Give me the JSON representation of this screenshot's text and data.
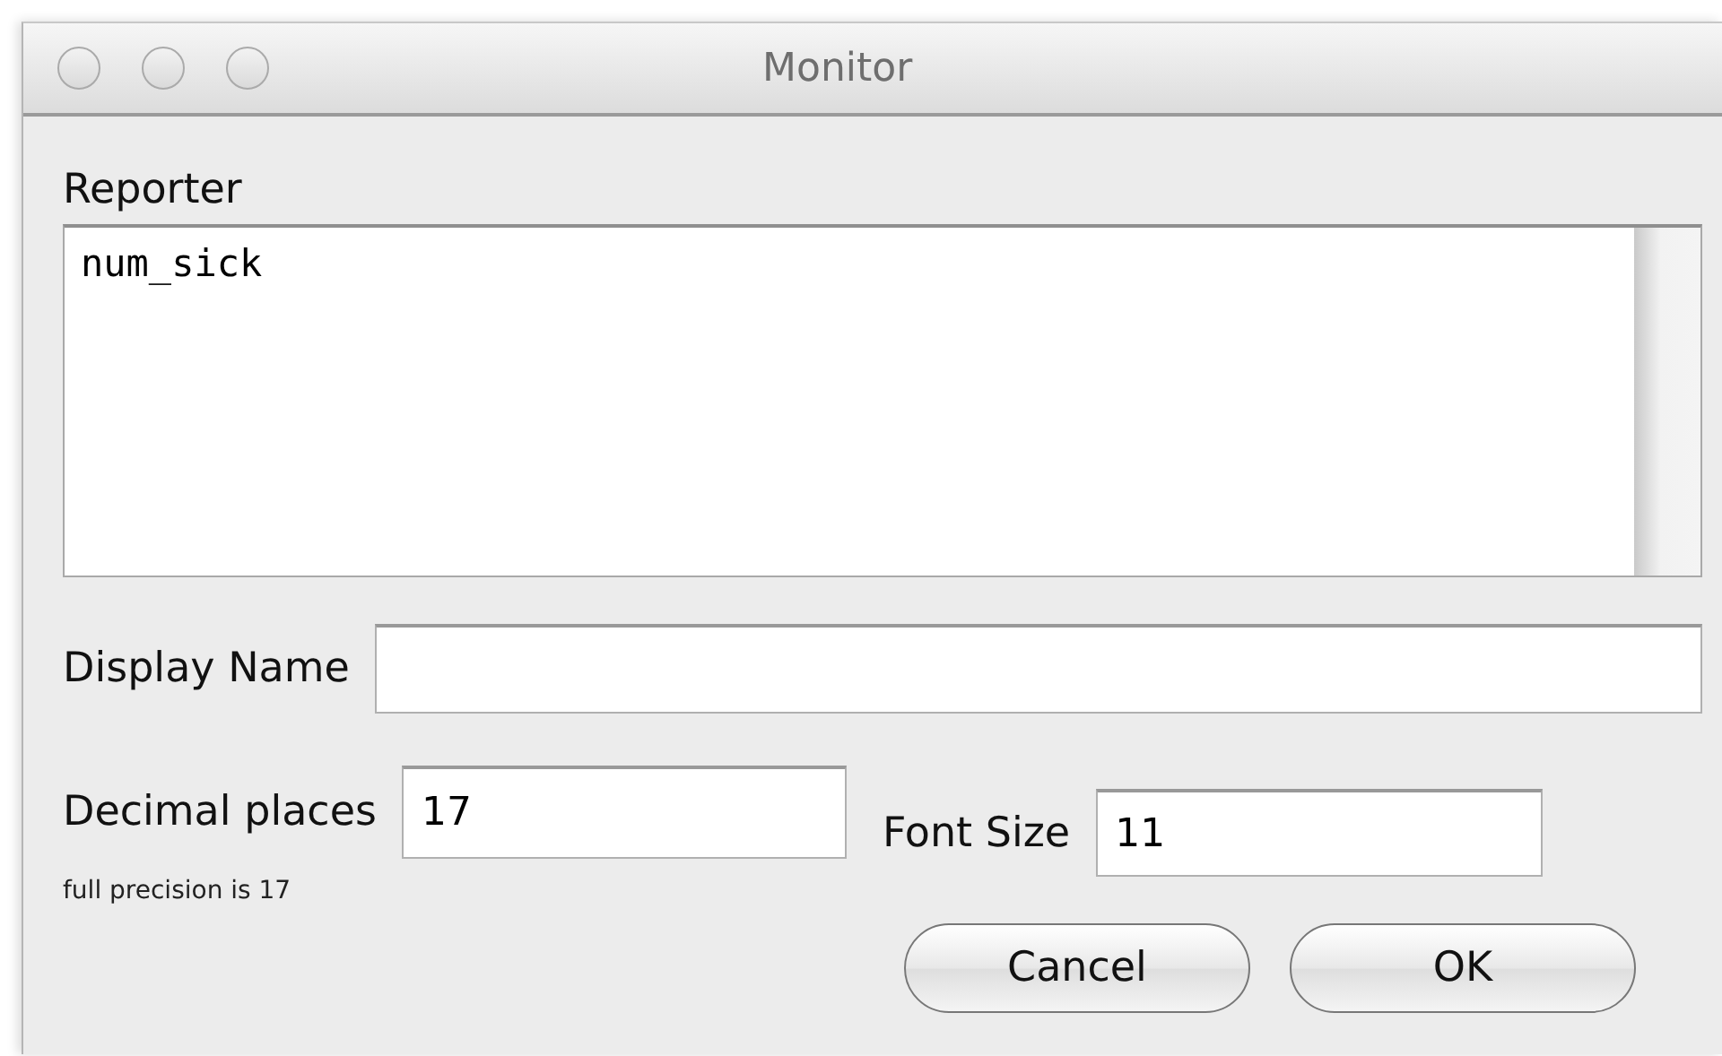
{
  "window": {
    "title": "Monitor"
  },
  "reporter": {
    "label": "Reporter",
    "value": "num_sick"
  },
  "display_name": {
    "label": "Display Name"
  },
  "decimal_places": {
    "label": "Decimal places",
    "value": "17",
    "hint": "full precision is 17"
  },
  "font_size": {
    "label": "Font Size",
    "value": "11"
  },
  "buttons": [
    "Cancel",
    "OK"
  ]
}
